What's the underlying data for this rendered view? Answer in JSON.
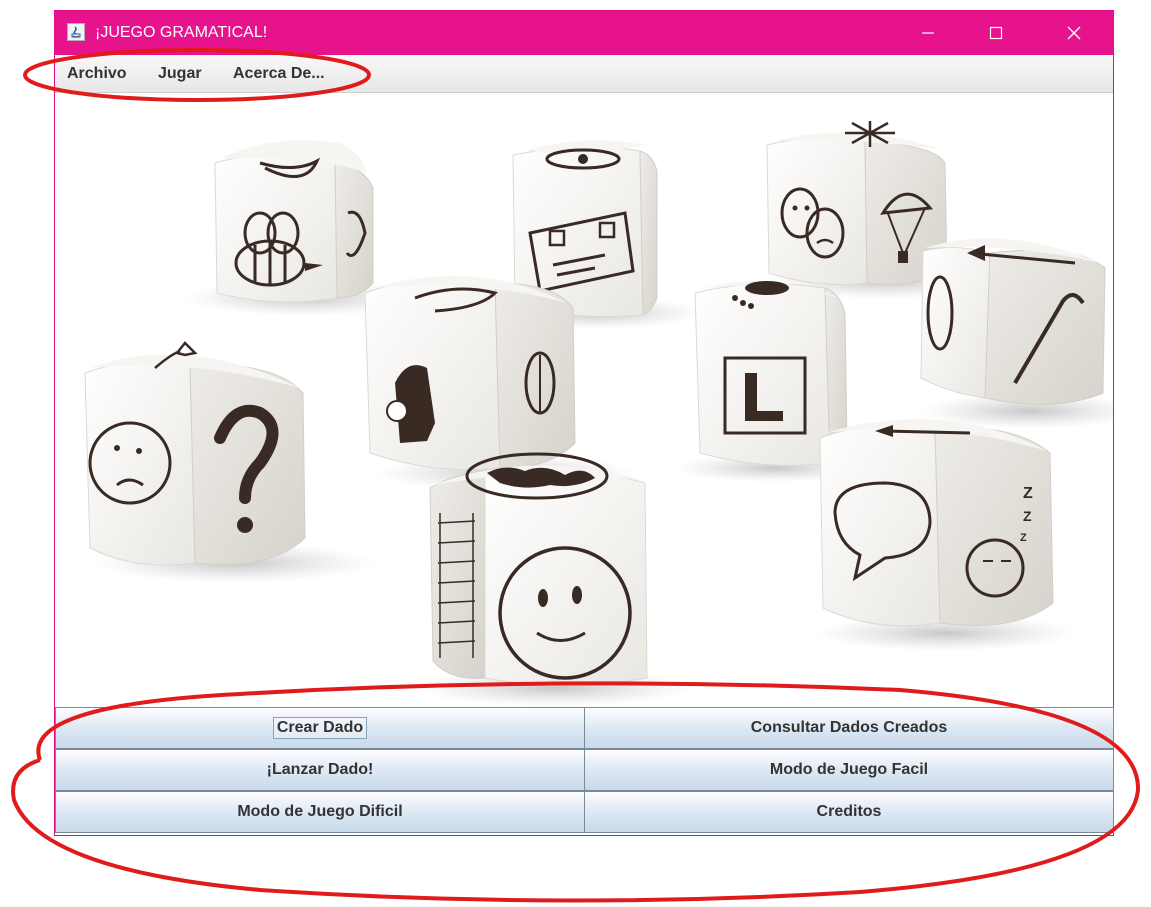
{
  "window": {
    "title": "¡JUEGO GRAMATICAL!",
    "accent_color": "#e6138c",
    "controls": {
      "minimize": "minimize-icon",
      "maximize": "maximize-icon",
      "close": "close-icon"
    }
  },
  "menu": {
    "items": [
      {
        "label": "Archivo"
      },
      {
        "label": "Jugar"
      },
      {
        "label": "Acerca De..."
      }
    ]
  },
  "main": {
    "image": "story-dice-photo"
  },
  "buttons": {
    "crear_dado": "Crear Dado",
    "consultar": "Consultar Dados Creados",
    "lanzar": "¡Lanzar Dado!",
    "facil": "Modo de Juego Facil",
    "dificil": "Modo de Juego Dificil",
    "creditos": "Creditos"
  },
  "annotations": {
    "color": "#e01b1b"
  }
}
